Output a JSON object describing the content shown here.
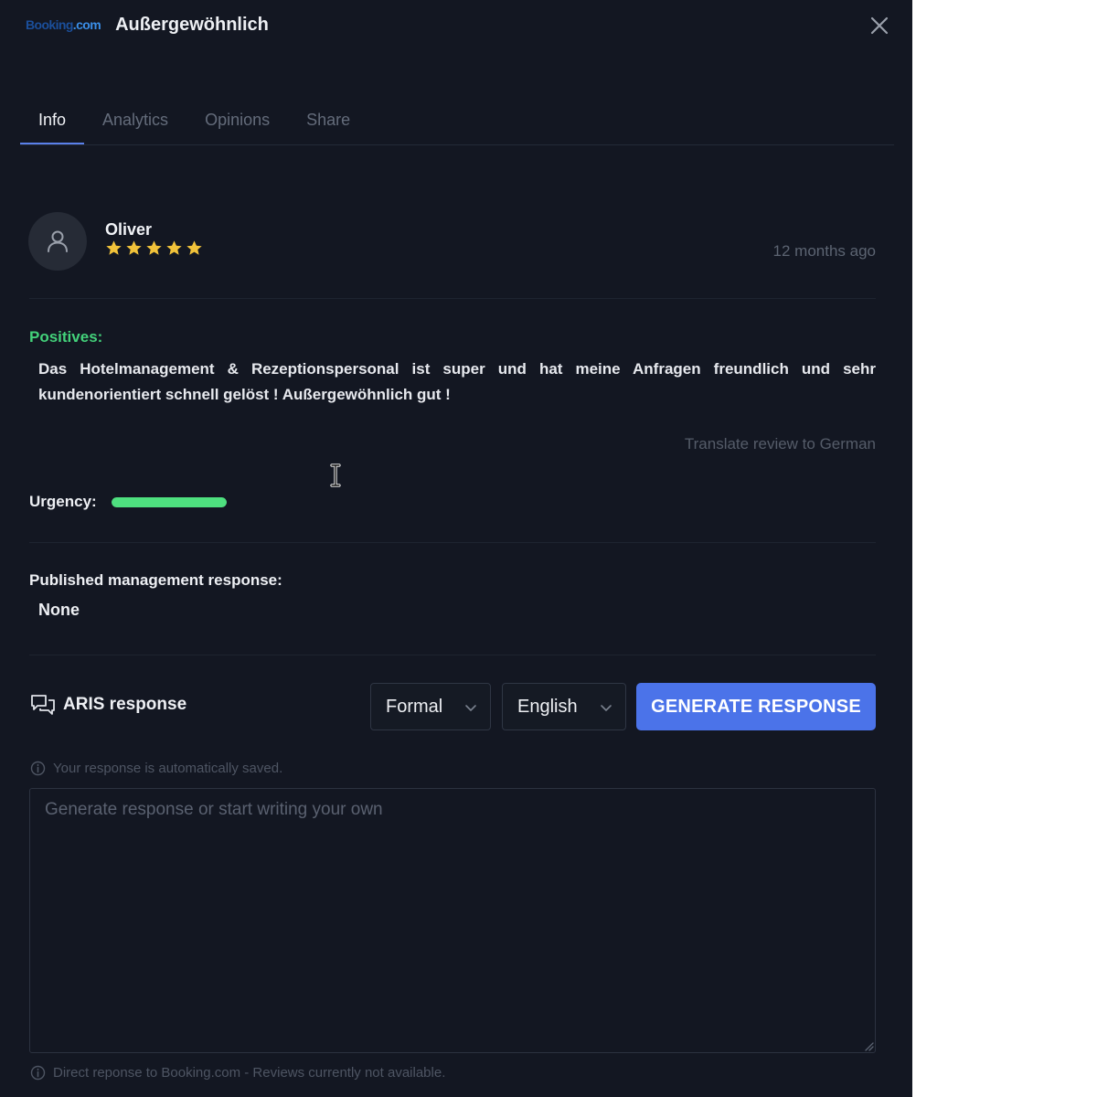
{
  "header": {
    "logo_text": "Booking.com",
    "logo_main": "Booking",
    "logo_suffix": ".com",
    "title": "Außergewöhnlich",
    "close_icon": "close-icon"
  },
  "tabs": [
    {
      "label": "Info",
      "active": true
    },
    {
      "label": "Analytics",
      "active": false
    },
    {
      "label": "Opinions",
      "active": false
    },
    {
      "label": "Share",
      "active": false
    }
  ],
  "review": {
    "avatar_icon": "user-icon",
    "reviewer": "Oliver",
    "rating": 5,
    "rating_max": 5,
    "time_ago": "12 months ago",
    "positives_label": "Positives:",
    "text": "Das Hotelmanagement & Rezeptionspersonal ist super und hat meine Anfragen freundlich und sehr kundenorientiert schnell gelöst ! Außergewöhnlich gut !",
    "translate_link": "Translate review to German"
  },
  "urgency": {
    "label": "Urgency:",
    "level": 1.0,
    "color": "#4ee07f"
  },
  "management_response": {
    "label": "Published management response:",
    "value": "None"
  },
  "aris": {
    "icon": "chat-bubbles-icon",
    "label": "ARIS response",
    "tone": "Formal",
    "language": "English",
    "generate_label": "GENERATE RESPONSE",
    "accent_color": "#4b73e9",
    "autosave_note": "Your response is automatically saved.",
    "placeholder": "Generate response or start writing your own",
    "footer_note": "Direct reponse to Booking.com - Reviews currently not available."
  }
}
